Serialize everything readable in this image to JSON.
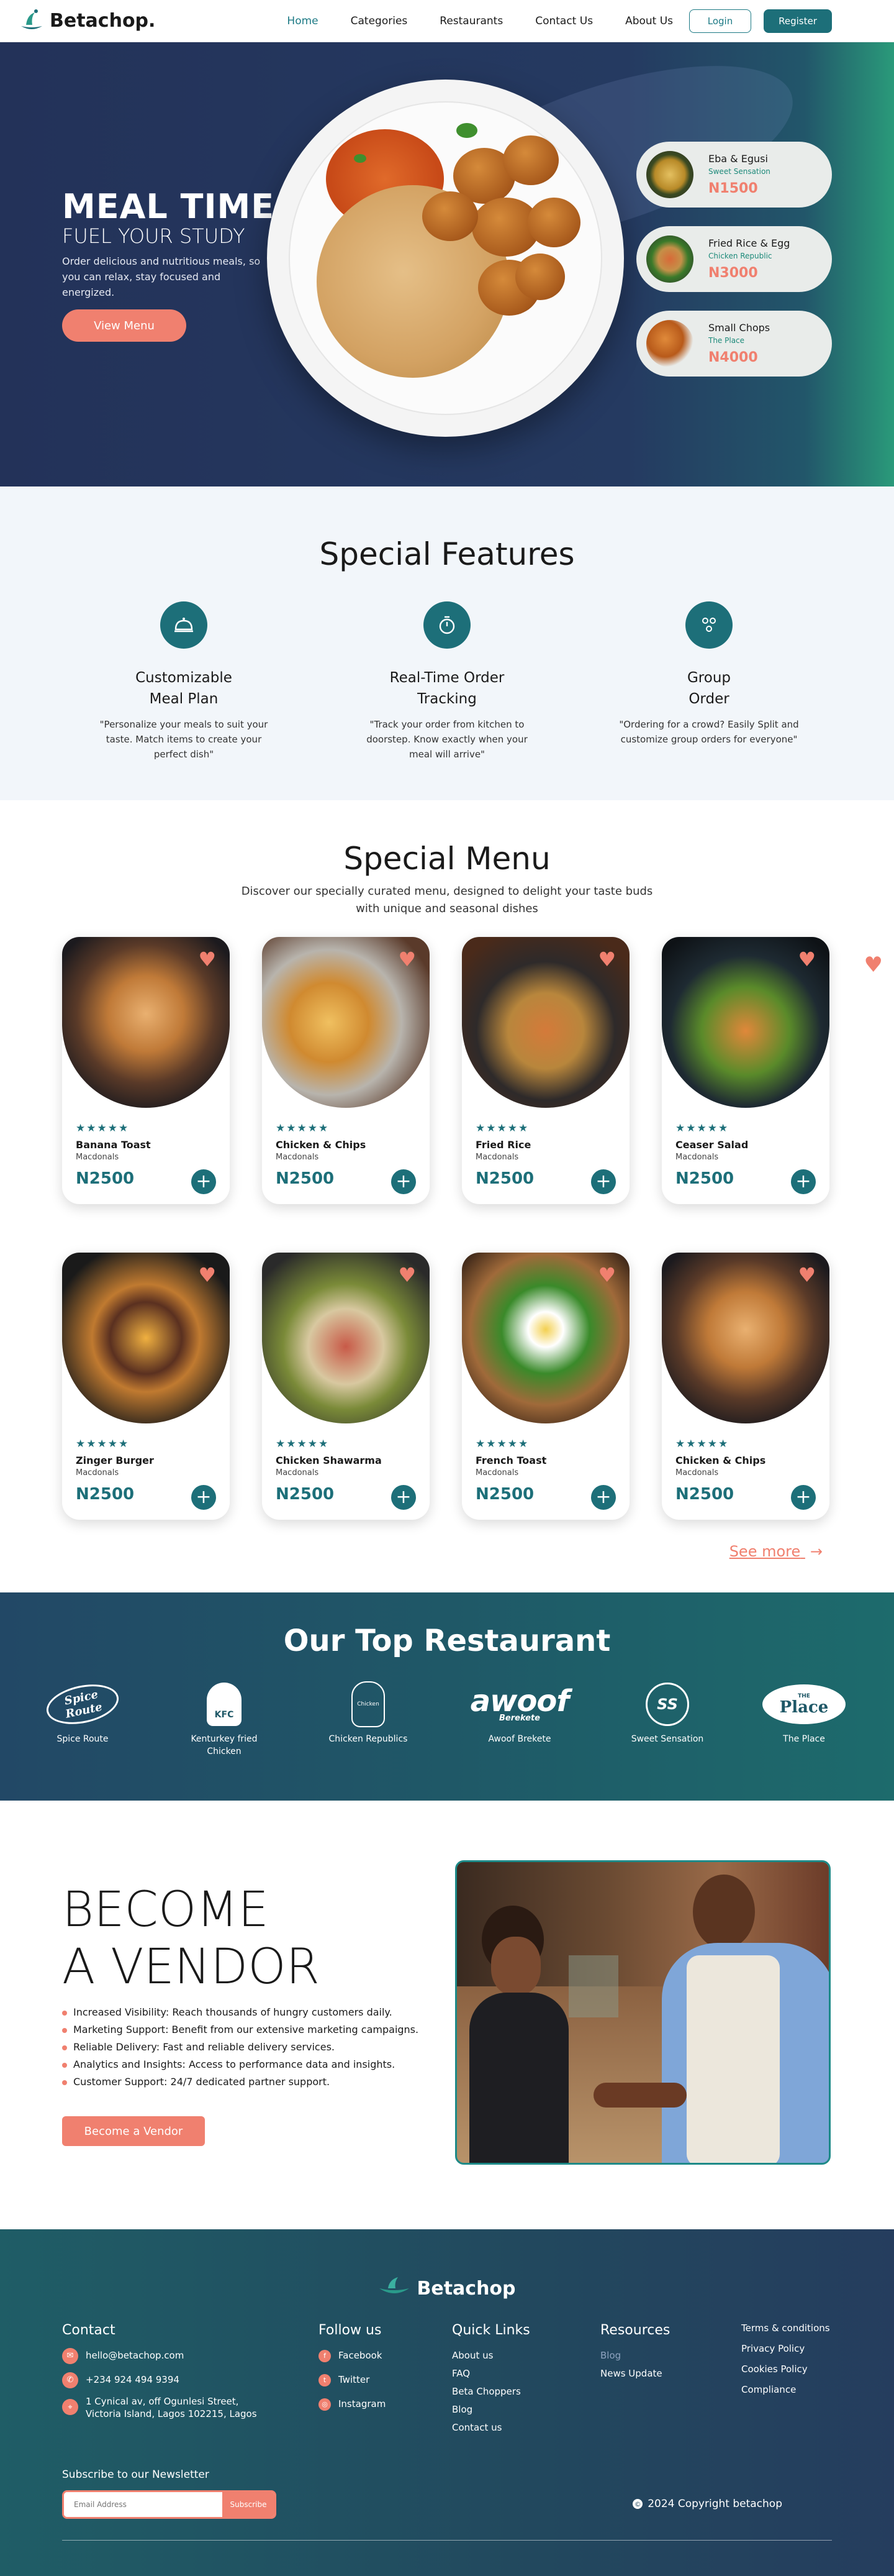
{
  "brand": {
    "name": "Betachop."
  },
  "nav": {
    "links": [
      "Home",
      "Categories",
      "Restaurants",
      "Contact Us",
      "About Us"
    ],
    "login": "Login",
    "register": "Register"
  },
  "hero": {
    "title": "MEAL TIME",
    "subtitle": "FUEL YOUR STUDY",
    "description": "Order delicious and nutritious meals, so you can relax, stay focused and energized.",
    "cta": "View Menu",
    "cards": [
      {
        "name": "Eba & Egusi",
        "shop": "Sweet Sensation",
        "price": "N1500"
      },
      {
        "name": "Fried Rice & Egg",
        "shop": "Chicken Republic",
        "price": "N3000"
      },
      {
        "name": "Small Chops",
        "shop": "The Place",
        "price": "N4000"
      }
    ]
  },
  "features": {
    "title": "Special Features",
    "items": [
      {
        "title_line1": "Customizable",
        "title_line2": "Meal Plan",
        "desc": "\"Personalize your meals to suit your taste. Match items to create your perfect dish\""
      },
      {
        "title_line1": "Real-Time Order",
        "title_line2": "Tracking",
        "desc": "\"Track your order from kitchen to doorstep. Know exactly when your meal will arrive\""
      },
      {
        "title_line1": "Group",
        "title_line2": "Order",
        "desc": "\"Ordering for a crowd? Easily Split and customize group orders for everyone\""
      }
    ]
  },
  "menu": {
    "title": "Special Menu",
    "subtitle": "Discover our specially curated menu, designed to delight your taste buds with unique and seasonal dishes",
    "stars": "★★★★★",
    "add": "+",
    "items": [
      {
        "name": "Banana Toast",
        "shop": "Macdonals",
        "price": "N2500"
      },
      {
        "name": "Chicken & Chips",
        "shop": "Macdonals",
        "price": "N2500"
      },
      {
        "name": "Fried Rice",
        "shop": "Macdonals",
        "price": "N2500"
      },
      {
        "name": "Ceaser Salad",
        "shop": "Macdonals",
        "price": "N2500"
      },
      {
        "name": "Zinger Burger",
        "shop": "Macdonals",
        "price": "N2500"
      },
      {
        "name": "Chicken Shawarma",
        "shop": "Macdonals",
        "price": "N2500"
      },
      {
        "name": "French Toast",
        "shop": "Macdonals",
        "price": "N2500"
      },
      {
        "name": "Chicken & Chips",
        "shop": "Macdonals",
        "price": "N2500"
      }
    ],
    "see_more": "See more"
  },
  "restaurants": {
    "title": "Our Top Restaurant",
    "items": [
      {
        "name": "Spice Route",
        "logo_text": "Spice Route"
      },
      {
        "name": "Kenturkey fried Chicken",
        "logo_text": "KFC"
      },
      {
        "name": "Chicken Republics",
        "logo_text": "Chicken"
      },
      {
        "name": "Awoof Brekete",
        "logo_text": "awoof",
        "logo_sub": "Berekete"
      },
      {
        "name": "Sweet Sensation",
        "logo_text": "SS"
      },
      {
        "name": "The Place",
        "logo_text": "Place",
        "logo_sub": "THE"
      }
    ]
  },
  "vendor": {
    "title_line1": "BECOME",
    "title_line2": "A VENDOR",
    "benefits": [
      "Increased Visibility: Reach thousands of hungry customers daily.",
      "Marketing Support: Benefit from our extensive marketing campaigns.",
      "Reliable Delivery: Fast and reliable delivery services.",
      "Analytics and Insights: Access to performance data and insights.",
      "Customer Support: 24/7 dedicated partner support."
    ],
    "cta": "Become a Vendor"
  },
  "footer": {
    "brand": "Betachop",
    "contact": {
      "title": "Contact",
      "email": "hello@betachop.com",
      "phone": "+234 924 494 9394",
      "address_line1": "1 Cynical av, off Ogunlesi Street,",
      "address_line2": "Victoria Island, Lagos 102215, Lagos"
    },
    "follow": {
      "title": "Follow us",
      "items": [
        "Facebook",
        "Twitter",
        "Instagram"
      ]
    },
    "quick_links": {
      "title": "Quick Links",
      "items": [
        "About us",
        "FAQ",
        "Beta Choppers",
        "Blog",
        "Contact us"
      ]
    },
    "resources": {
      "title": "Resources",
      "items": [
        "Blog",
        "News Update"
      ]
    },
    "legal": [
      "Terms & conditions",
      "Privacy Policy",
      "Cookies Policy",
      "Compliance"
    ],
    "newsletter": {
      "label": "Subscribe to our Newsletter",
      "placeholder": "Email Address",
      "button": "Subscribe"
    },
    "copyright": "2024 Copyright  betachop"
  },
  "colors": {
    "primary": "#1d6f79",
    "accent": "#f0806f",
    "hero_bg": "#253a61"
  }
}
